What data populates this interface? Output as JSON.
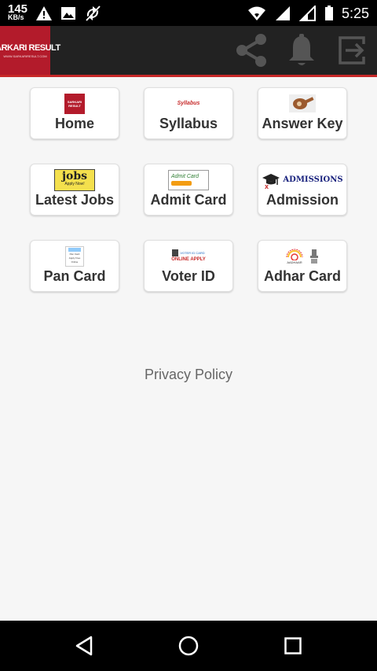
{
  "status_bar": {
    "net_speed_value": "145",
    "net_speed_unit": "KB/s",
    "time": "5:25"
  },
  "app_bar": {
    "logo_text": "SARKARI RESULT",
    "logo_subtext": "WWW.SARKARIRESULT.COM"
  },
  "tiles": [
    {
      "label": "Home",
      "icon": "sarkari-result-logo"
    },
    {
      "label": "Syllabus",
      "icon": "syllabus-image"
    },
    {
      "label": "Answer Key",
      "icon": "answer-key-image"
    },
    {
      "label": "Latest Jobs",
      "icon": "jobs-image"
    },
    {
      "label": "Admit Card",
      "icon": "admit-card-image"
    },
    {
      "label": "Admission",
      "icon": "admissions-image"
    },
    {
      "label": "Pan Card",
      "icon": "pan-card-image"
    },
    {
      "label": "Voter ID",
      "icon": "voter-id-image"
    },
    {
      "label": "Adhar Card",
      "icon": "aadhaar-image"
    }
  ],
  "tile_image_texts": {
    "home": "SARKARI RESULT",
    "syllabus": "Syllabus",
    "jobs": "jobs",
    "jobs_sub": "Apply Now!",
    "admit": "Admit Card",
    "admissions": "ADMISSIONS",
    "pan_1": "Pan Card",
    "pan_2": "Apply Free",
    "pan_3": "Online",
    "voter": "VOTER ID CARD",
    "voter_sub": "ONLINE APPLY",
    "aadhaar": "AADHAAR"
  },
  "footer": {
    "privacy_policy": "Privacy Policy"
  },
  "colors": {
    "brand_red": "#b31b2b",
    "appbar_bg": "#222222",
    "accent_line": "#c62828"
  }
}
